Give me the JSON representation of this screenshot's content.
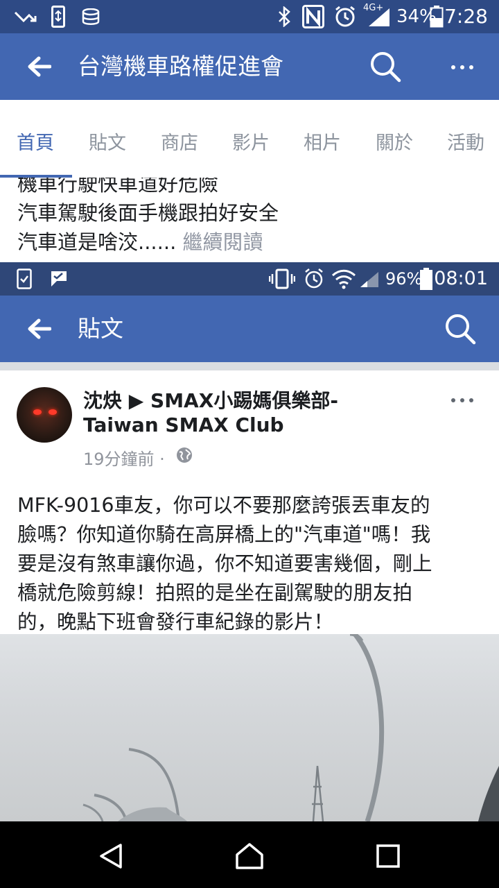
{
  "outer_status": {
    "battery": "34%",
    "time": "7:28",
    "network": "4G+"
  },
  "page_header": {
    "title": "台灣機車路權促進會"
  },
  "tabs": [
    {
      "label": "首頁"
    },
    {
      "label": "貼文"
    },
    {
      "label": "商店"
    },
    {
      "label": "影片"
    },
    {
      "label": "相片"
    },
    {
      "label": "關於"
    },
    {
      "label": "活動"
    }
  ],
  "excerpt": {
    "line1": "機車行駛快車道好危險",
    "line2": "汽車駕駛後面手機跟拍好安全",
    "line3": "汽車道是啥洨......",
    "more": "繼續閱讀"
  },
  "inner_status": {
    "battery": "96%",
    "time": "08:01"
  },
  "inner_header": {
    "title": "貼文"
  },
  "post": {
    "author_line1": "沈炔 ▶ SMAX小踢媽俱樂部-",
    "author_line2": "Taiwan SMAX Club",
    "time_ago": "19分鐘前 ·",
    "body_lines": [
      "MFK-9016車友，你可以不要那麼誇張丟車友的",
      "臉嗎？你知道你騎在高屏橋上的\"汽車道\"嗎！我",
      "要是沒有煞車讓你過，你不知道要害幾個，剛上",
      "橋就危險剪線！拍照的是坐在副駕駛的朋友拍",
      "的，晚點下班會發行車紀錄的影片！"
    ]
  },
  "colors": {
    "header_blue": "#4267b2",
    "status_dark": "#2e4a85",
    "text": "#1c1e21",
    "muted": "#90949c"
  },
  "icons": [
    "back-arrow-icon",
    "search-icon",
    "more-icon",
    "globe-icon",
    "nav-back-icon",
    "nav-home-icon",
    "nav-recents-icon"
  ]
}
